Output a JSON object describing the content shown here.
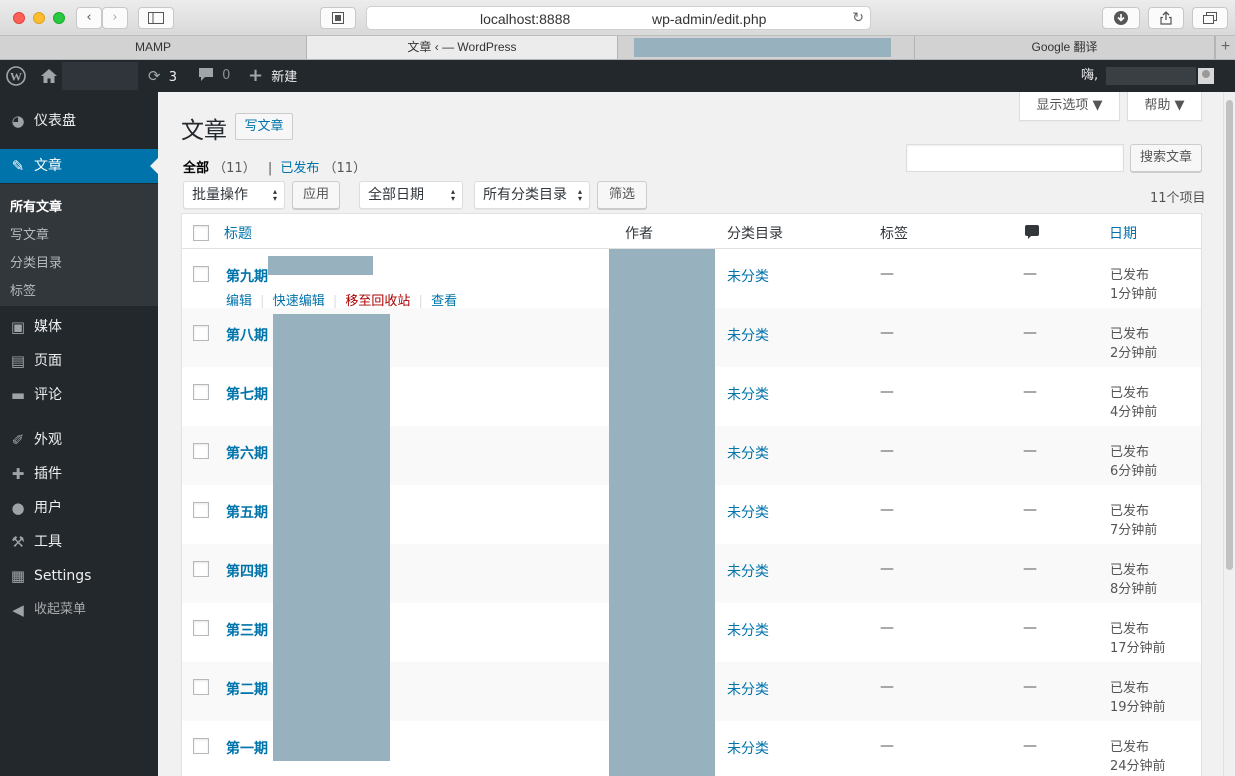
{
  "browser": {
    "url_prefix": "localhost:8888/",
    "url_suffix": "wp-admin/edit.php",
    "tabs": [
      {
        "label": "MAMP"
      },
      {
        "label": "文章 ‹              — WordPress"
      },
      {
        "label": ""
      },
      {
        "label": "Google 翻译"
      }
    ]
  },
  "adminbar": {
    "updates_count": "3",
    "comments_count": "0",
    "new_label": "新建",
    "howdy": "嗨,"
  },
  "sidebar": {
    "items": [
      {
        "label": "仪表盘",
        "icon": "dashboard-icon"
      },
      {
        "label": "文章",
        "icon": "pin-icon"
      },
      {
        "label": "媒体",
        "icon": "media-icon"
      },
      {
        "label": "页面",
        "icon": "pages-icon"
      },
      {
        "label": "评论",
        "icon": "comment-icon"
      },
      {
        "label": "外观",
        "icon": "brush-icon"
      },
      {
        "label": "插件",
        "icon": "plugin-icon"
      },
      {
        "label": "用户",
        "icon": "user-icon"
      },
      {
        "label": "工具",
        "icon": "wrench-icon"
      },
      {
        "label": "Settings",
        "icon": "settings-icon"
      },
      {
        "label": "收起菜单",
        "icon": "collapse-icon"
      }
    ],
    "submenu": [
      "所有文章",
      "写文章",
      "分类目录",
      "标签"
    ]
  },
  "header": {
    "screen_options": "显示选项 ▼",
    "help": "帮助 ▼",
    "title": "文章",
    "add_new": "写文章"
  },
  "filters": {
    "all_label": "全部",
    "all_count": "（11）",
    "sep": "|",
    "published_label": "已发布",
    "published_count": "（11）",
    "search_button": "搜索文章",
    "bulk_actions": "批量操作",
    "apply": "应用",
    "all_dates": "全部日期",
    "all_categories": "所有分类目录",
    "filter": "筛选",
    "item_count": "11个项目"
  },
  "table": {
    "columns": {
      "title": "标题",
      "author": "作者",
      "categories": "分类目录",
      "tags": "标签",
      "date": "日期"
    },
    "row_actions": {
      "edit": "编辑",
      "quick_edit": "快速编辑",
      "trash": "移至回收站",
      "view": "查看",
      "sep": "|"
    },
    "rows": [
      {
        "title": "第九期",
        "category": "未分类",
        "tags": "—",
        "comments": "—",
        "status": "已发布",
        "time": "1分钟前"
      },
      {
        "title": "第八期",
        "category": "未分类",
        "tags": "—",
        "comments": "—",
        "status": "已发布",
        "time": "2分钟前"
      },
      {
        "title": "第七期",
        "category": "未分类",
        "tags": "—",
        "comments": "—",
        "status": "已发布",
        "time": "4分钟前"
      },
      {
        "title": "第六期",
        "category": "未分类",
        "tags": "—",
        "comments": "—",
        "status": "已发布",
        "time": "6分钟前"
      },
      {
        "title": "第五期",
        "category": "未分类",
        "tags": "—",
        "comments": "—",
        "status": "已发布",
        "time": "7分钟前"
      },
      {
        "title": "第四期",
        "category": "未分类",
        "tags": "—",
        "comments": "—",
        "status": "已发布",
        "time": "8分钟前"
      },
      {
        "title": "第三期",
        "category": "未分类",
        "tags": "—",
        "comments": "—",
        "status": "已发布",
        "time": "17分钟前"
      },
      {
        "title": "第二期",
        "category": "未分类",
        "tags": "—",
        "comments": "—",
        "status": "已发布",
        "time": "19分钟前"
      },
      {
        "title": "第一期",
        "category": "未分类",
        "tags": "—",
        "comments": "—",
        "status": "已发布",
        "time": "24分钟前"
      }
    ]
  }
}
